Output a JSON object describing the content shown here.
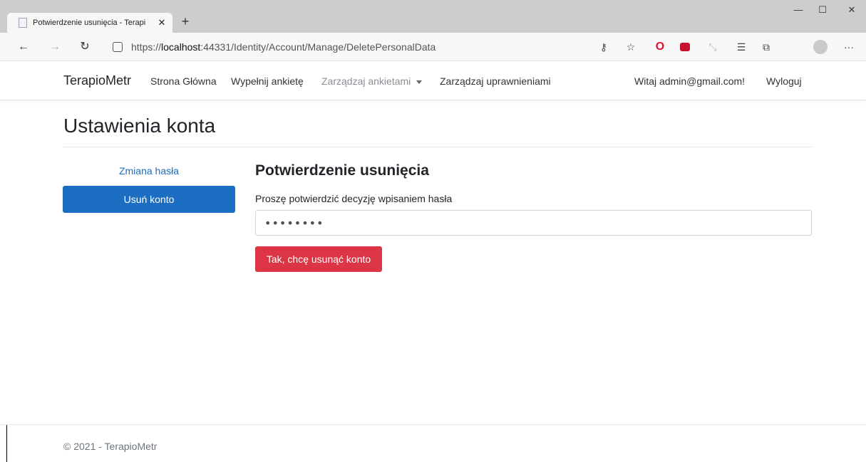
{
  "browser": {
    "tab_title": "Potwierdzenie usunięcia - Terapi",
    "tab_close": "✕",
    "new_tab": "+",
    "window": {
      "minimize": "—",
      "maximize": "☐",
      "close": "✕"
    },
    "back": "←",
    "forward": "→",
    "refresh": "↻",
    "url_prefix": "https://",
    "url_host": "localhost",
    "url_rest": ":44331/Identity/Account/Manage/DeletePersonalData",
    "more": "···"
  },
  "nav": {
    "brand": "TerapioMetr",
    "links": [
      "Strona Główna",
      "Wypełnij ankietę",
      "Zarządzaj ankietami",
      "Zarządzaj uprawnieniami"
    ],
    "greeting": "Witaj admin@gmail.com!",
    "logout": "Wyloguj"
  },
  "main": {
    "title": "Ustawienia konta",
    "sidebar": {
      "items": [
        {
          "label": "Zmiana hasła"
        },
        {
          "label": "Usuń konto"
        }
      ]
    },
    "section_title": "Potwierdzenie usunięcia",
    "field_label": "Proszę potwierdzić decyzję wpisaniem hasła",
    "password_value": "••••••••",
    "confirm_button": "Tak, chcę usunąć konto"
  },
  "footer": {
    "text": "© 2021 - TerapioMetr"
  },
  "colors": {
    "primary": "#1b6ec2",
    "danger": "#dc3545"
  }
}
